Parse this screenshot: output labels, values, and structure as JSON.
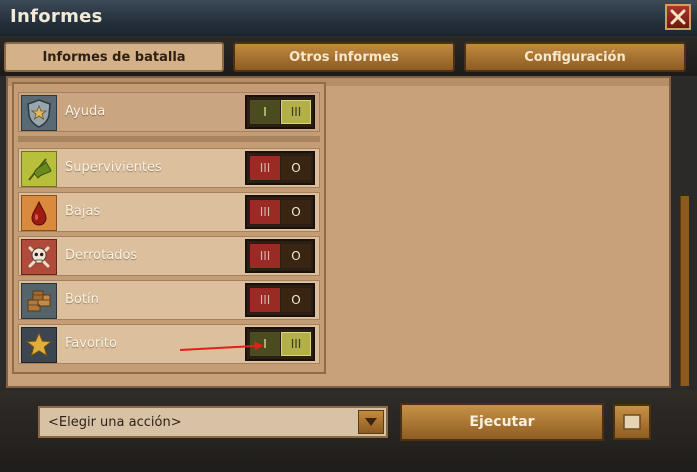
{
  "window": {
    "title": "Informes"
  },
  "tabs": [
    {
      "label": "Informes de batalla",
      "active": true
    },
    {
      "label": "Otros informes",
      "active": false
    },
    {
      "label": "Configuración",
      "active": false
    }
  ],
  "rows": [
    {
      "label": "Ayuda",
      "icon": "shield-star-icon",
      "toggle_left": "I",
      "toggle_right": "III",
      "state": "on"
    },
    {
      "label": "Supervivientes",
      "icon": "flag-icon",
      "toggle_left": "III",
      "toggle_right": "O",
      "state": "off"
    },
    {
      "label": "Bajas",
      "icon": "blood-drop-icon",
      "toggle_left": "III",
      "toggle_right": "O",
      "state": "off"
    },
    {
      "label": "Derrotados",
      "icon": "skull-icon",
      "toggle_left": "III",
      "toggle_right": "O",
      "state": "off"
    },
    {
      "label": "Botín",
      "icon": "loot-crates-icon",
      "toggle_left": "III",
      "toggle_right": "O",
      "state": "off"
    },
    {
      "label": "Favorito",
      "icon": "star-icon",
      "toggle_left": "I",
      "toggle_right": "III",
      "state": "on"
    }
  ],
  "footer": {
    "select_value": "<Elegir una acción>",
    "execute_label": "Ejecutar"
  },
  "colors": {
    "accent": "#c69146",
    "panel": "#c8a07a",
    "toggle_on": "#b3b04a",
    "toggle_off": "#9a2a24"
  }
}
